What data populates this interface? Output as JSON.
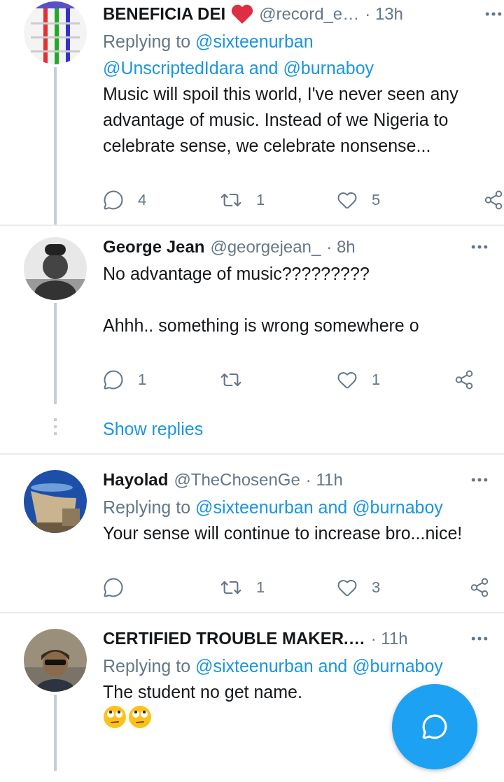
{
  "tweets": [
    {
      "name": "BENEFICIA DEI",
      "name_icon": {
        "kind": "heart"
      },
      "handle": "@record_e…",
      "time": "· 13h",
      "replying_to": {
        "label": "Replying to",
        "links": [
          "@sixteenurban",
          "@UnscriptedIdara and @burnaboy"
        ]
      },
      "body": "Music will spoil this world, I've never seen any advantage of music. Instead of we Nigeria to celebrate sense, we celebrate nonsense...",
      "actions": {
        "replies": "4",
        "retweets": "1",
        "likes": "5"
      },
      "thread_below": true
    },
    {
      "name": "George Jean",
      "handle": "@georgejean_",
      "time": "· 8h",
      "body": "No advantage of music?????????\n\nAhhh.. something is wrong somewhere o",
      "actions": {
        "replies": "1",
        "likes": "1"
      },
      "thread_below": true,
      "show_replies": "Show replies"
    },
    {
      "name": "Hayolad",
      "handle": "@TheChosenGe",
      "time": "· 11h",
      "replying_to": {
        "label": "Replying to",
        "links": [
          "@sixteenurban and @burnaboy"
        ]
      },
      "body": "Your sense will continue to increase bro...nice!",
      "actions": {
        "retweets": "1",
        "likes": "3"
      },
      "thread_below": false
    },
    {
      "name": "CERTIFIED TROUBLE MAKER.…",
      "time": "· 11h",
      "replying_to": {
        "label": "Replying to",
        "links": [
          "@sixteenurban and @burnaboy"
        ]
      },
      "body": "The student no get name.",
      "emojis": [
        {
          "kind": "eye-roll"
        },
        {
          "kind": "eye-roll"
        }
      ],
      "thread_below": true
    }
  ],
  "compose_button": {
    "kind": "reply"
  }
}
